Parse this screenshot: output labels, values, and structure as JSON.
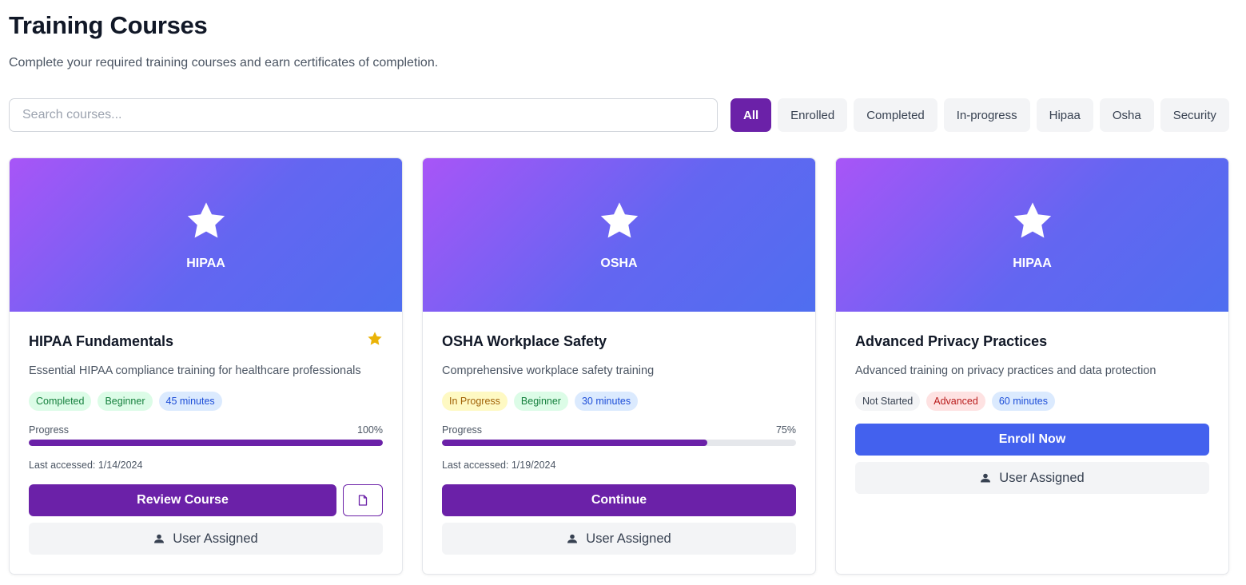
{
  "header": {
    "title": "Training Courses",
    "subtitle": "Complete your required training courses and earn certificates of completion."
  },
  "search": {
    "placeholder": "Search courses...",
    "value": ""
  },
  "filters": [
    {
      "label": "All",
      "active": true
    },
    {
      "label": "Enrolled",
      "active": false
    },
    {
      "label": "Completed",
      "active": false
    },
    {
      "label": "In-progress",
      "active": false
    },
    {
      "label": "Hipaa",
      "active": false
    },
    {
      "label": "Osha",
      "active": false
    },
    {
      "label": "Security",
      "active": false
    }
  ],
  "colors": {
    "accent": "#6b21a8",
    "enroll": "#4361ee",
    "favorite": "#eab308",
    "gradient_start": "#a855f7",
    "gradient_end": "#4f6ef0"
  },
  "courses": [
    {
      "category": "HIPAA",
      "title": "HIPAA Fundamentals",
      "description": "Essential HIPAA compliance training for healthcare professionals",
      "favorite": true,
      "badges": {
        "status": "Completed",
        "level": "Beginner",
        "duration": "45 minutes"
      },
      "progress_label": "Progress",
      "progress_text": "100%",
      "progress_fraction": 1.0,
      "last_accessed": "Last accessed: 1/14/2024",
      "primary_action": "Review Course",
      "certificate_icon": "document-icon",
      "assigned_label": "User Assigned"
    },
    {
      "category": "OSHA",
      "title": "OSHA Workplace Safety",
      "description": "Comprehensive workplace safety training",
      "favorite": false,
      "badges": {
        "status": "In Progress",
        "level": "Beginner",
        "duration": "30 minutes"
      },
      "progress_label": "Progress",
      "progress_text": "75%",
      "progress_fraction": 0.75,
      "last_accessed": "Last accessed: 1/19/2024",
      "primary_action": "Continue",
      "assigned_label": "User Assigned"
    },
    {
      "category": "HIPAA",
      "title": "Advanced Privacy Practices",
      "description": "Advanced training on privacy practices and data protection",
      "favorite": false,
      "badges": {
        "status": "Not Started",
        "level": "Advanced",
        "duration": "60 minutes"
      },
      "primary_action": "Enroll Now",
      "assigned_label": "User Assigned"
    }
  ]
}
